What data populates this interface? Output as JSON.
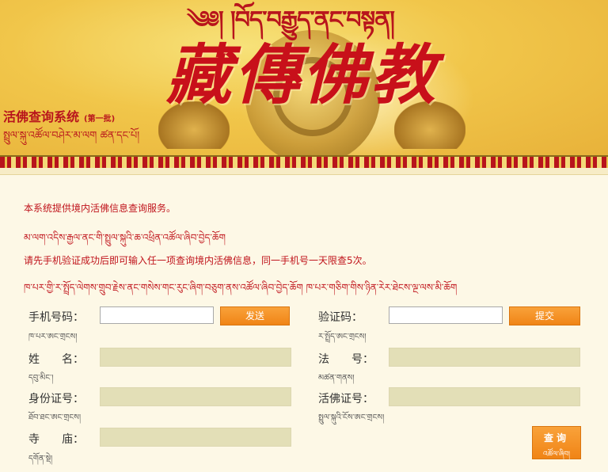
{
  "header": {
    "tibetan_title": "༄༅། །བོད་བརྒྱུད་ནང་བསྟན།",
    "main_title": "藏傳佛教",
    "system_title": "活佛查询系统",
    "system_batch": "(第一批)",
    "system_tibetan": "སྤྲུལ་སྐུ་འཚོལ་བཤེར་མ་ལག  ཚན་དང་པོ།"
  },
  "info": {
    "line1": "本系统提供境内活佛信息查询服务。",
    "line2": "མ་ལག་འདིས་རྒྱལ་ནང་གི་སྤྲུལ་སྐུའི་ཆ་འཕྲིན་འཚོལ་ཞིབ་བྱེད་ཆོག",
    "line3": "请先手机验证成功后即可输入任一项查询境内活佛信息，同一手机号一天限查5次。",
    "line4": "ཁ་པར་གྱི་ར་སྤྲོད་ལེགས་གྲུབ་རྗེས་ནང་གསེས་གང་རུང་ཞིག་བཅུག་ནས་འཚོལ་ཞིབ་བྱེད་ཆོག ཁ་པར་གཅིག་གིས་ཉིན་རེར་ཐེངས་ལྔ་ལས་མི་ཆོག"
  },
  "form": {
    "phone": {
      "label": "手机号码：",
      "sub": "ཁ་པར་ཨང་གྲངས།",
      "value": "",
      "placeholder": ""
    },
    "send_button": "发送",
    "code": {
      "label": "验证码：",
      "sub": "ར་སྤྲོད་ཨང་གྲངས།",
      "value": "",
      "placeholder": ""
    },
    "submit_button": "提交",
    "name": {
      "label": "姓　　名：",
      "sub": "དབུ་མིང་།",
      "value": ""
    },
    "dharma_name": {
      "label": "法　　号：",
      "sub": "མཚན་གནས།",
      "value": ""
    },
    "id_number": {
      "label": "身份证号：",
      "sub": "ཐོབ་ཐང་ཨང་གྲངས།",
      "value": ""
    },
    "living_buddha_id": {
      "label": "活佛证号：",
      "sub": "སྤྲུལ་སྐུའི་ངོས་ཨང་གྲངས།",
      "value": ""
    },
    "temple": {
      "label": "寺　　庙：",
      "sub": "དགོན་སྡེ།",
      "value": ""
    },
    "query_button": {
      "label": "查询",
      "sub": "འཚོལ་ཞིབ།"
    }
  },
  "colors": {
    "accent_red": "#c0141c",
    "button_orange": "#f08416",
    "field_tan": "#e3dfb7",
    "page_bg": "#fdf8e6"
  }
}
